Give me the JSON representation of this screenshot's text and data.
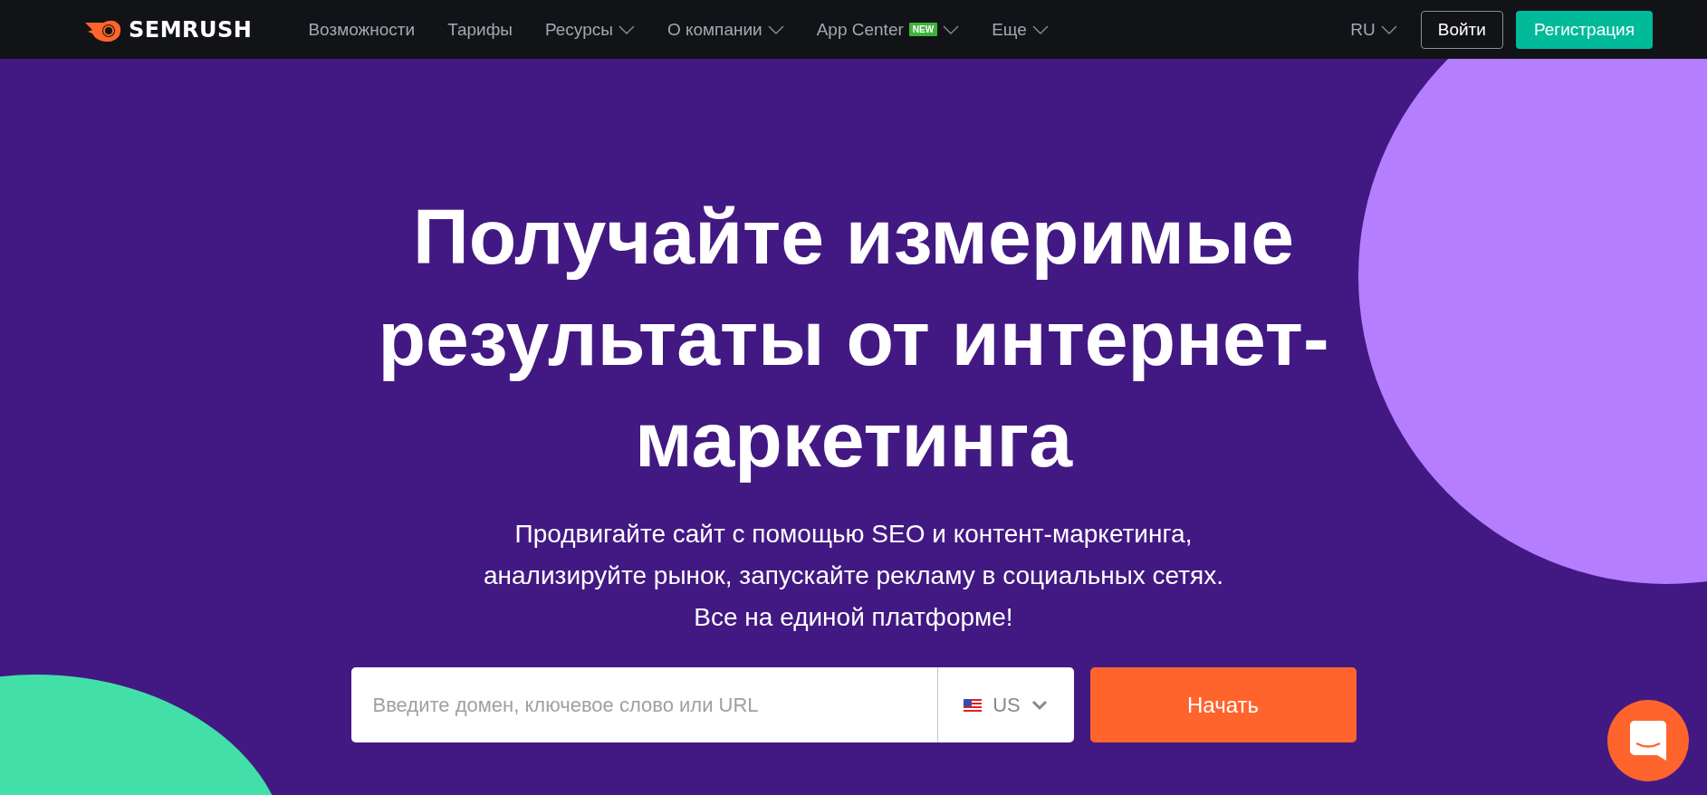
{
  "header": {
    "logo": "SEMRUSH",
    "menu": [
      {
        "label": "Возможности",
        "dropdown": false
      },
      {
        "label": "Тарифы",
        "dropdown": false
      },
      {
        "label": "Ресурсы",
        "dropdown": true
      },
      {
        "label": "О компании",
        "dropdown": true
      },
      {
        "label": "App Center",
        "badge": "NEW",
        "dropdown": true
      },
      {
        "label": "Еще",
        "dropdown": true
      }
    ],
    "language": {
      "label": "RU",
      "dropdown": true
    },
    "login": "Войти",
    "signup": "Регистрация"
  },
  "hero": {
    "title_lines": [
      "Получайте измеримые",
      "результаты от интернет-",
      "маркетинга"
    ],
    "subtitle_lines": [
      "Продвигайте сайт с помощью SEO и контент-маркетинга,",
      "анализируйте рынок, запускайте рекламу в социальных сетях.",
      "Все на единой платформе!"
    ],
    "search": {
      "placeholder": "Введите домен, ключевое слово или URL",
      "country": "US",
      "button": "Начать"
    }
  }
}
